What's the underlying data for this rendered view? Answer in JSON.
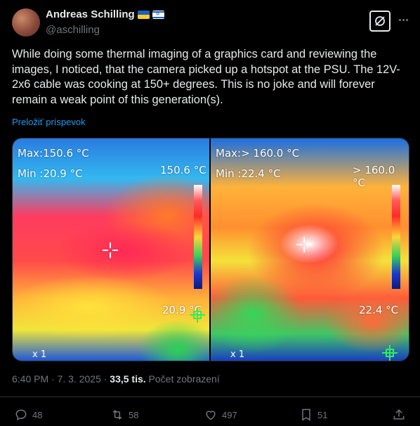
{
  "author": {
    "name": "Andreas Schilling",
    "handle": "@aschilling",
    "flags": [
      "ukraine-flag",
      "israel-flag"
    ]
  },
  "post": {
    "text": "While doing some thermal imaging of a graphics card and reviewing the images, I noticed, that the camera picked up a hotspot at the PSU. The 12V-2x6 cable was cooking at 150+ degrees. This is no joke and will forever remain a weak point of this generation(s).",
    "translate_label": "Preložiť príspevok"
  },
  "images": [
    {
      "max": "Max:150.6 °C",
      "min": "Min :20.9 °C",
      "scale_top": "150.6 °C",
      "scale_bottom": "20.9 °C",
      "zoom": "x 1"
    },
    {
      "max": "Max:> 160.0 °C",
      "min": "Min :22.4 °C",
      "scale_top": "> 160.0 °C",
      "scale_bottom": "22.4 °C",
      "zoom": "x 1"
    }
  ],
  "meta": {
    "time": "6:40 PM · 7. 3. 2025 · ",
    "views": "33,5 tis.",
    "views_label": " Počet zobrazení"
  },
  "actions": {
    "replies": "48",
    "reposts": "58",
    "likes": "497",
    "bookmarks": "51"
  },
  "colors": {
    "accent": "#1d9bf0",
    "muted": "#71767b",
    "text": "#e7e9ea",
    "background": "#000000"
  }
}
